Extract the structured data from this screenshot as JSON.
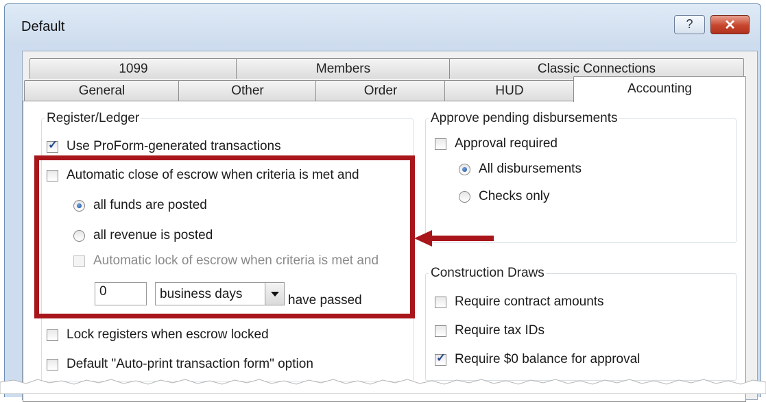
{
  "window": {
    "title": "Default",
    "help_label": "?",
    "close_label": "✕"
  },
  "tabs_row1": [
    {
      "label": "1099"
    },
    {
      "label": "Members"
    },
    {
      "label": "Classic Connections"
    }
  ],
  "tabs_row2": [
    {
      "label": "General"
    },
    {
      "label": "Other"
    },
    {
      "label": "Order"
    },
    {
      "label": "HUD"
    },
    {
      "label": "Accounting",
      "active": true
    }
  ],
  "register_ledger": {
    "legend": "Register/Ledger",
    "use_proform": {
      "label": "Use ProForm-generated transactions",
      "checked": true
    },
    "auto_close": {
      "label": "Automatic close of escrow when criteria is met and",
      "checked": false
    },
    "all_funds": {
      "label": "all funds are posted",
      "checked": true
    },
    "all_revenue": {
      "label": "all revenue is posted",
      "checked": false
    },
    "auto_lock": {
      "label": "Automatic lock of escrow when criteria is met and",
      "checked": false,
      "disabled": true
    },
    "days_value": "0",
    "days_unit": "business days",
    "have_passed": "have passed",
    "lock_registers": {
      "label": "Lock registers when escrow locked",
      "checked": false
    },
    "auto_print": {
      "label": "Default \"Auto-print transaction form\" option",
      "checked": false
    }
  },
  "approve_disbursements": {
    "legend": "Approve pending disbursements",
    "approval_required": {
      "label": "Approval required",
      "checked": false
    },
    "all_disbursements": {
      "label": "All disbursements",
      "checked": true
    },
    "checks_only": {
      "label": "Checks only",
      "checked": false
    }
  },
  "construction_draws": {
    "legend": "Construction Draws",
    "contract_amounts": {
      "label": "Require contract amounts",
      "checked": false
    },
    "tax_ids": {
      "label": "Require tax IDs",
      "checked": false
    },
    "zero_balance": {
      "label": "Require $0 balance for approval",
      "checked": true
    }
  },
  "colors": {
    "annotation": "#a8151a",
    "window_frame": "#6d8fb3",
    "close_button": "#c7452c"
  }
}
